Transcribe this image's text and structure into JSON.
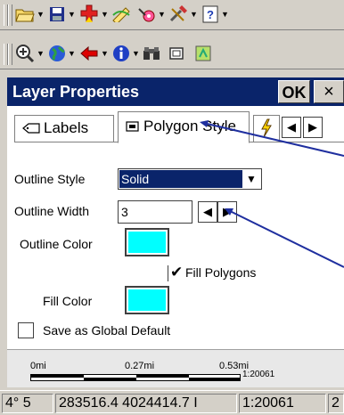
{
  "toolbar1": {
    "icons": [
      "open-folder-icon",
      "save-icon",
      "add-layer-icon",
      "draw-tool-icon",
      "waypoint-icon",
      "tools-icon",
      "help-icon"
    ]
  },
  "toolbar2": {
    "icons": [
      "zoom-in-icon",
      "globe-icon",
      "back-arrow-icon",
      "info-icon",
      "binoculars-icon",
      "window-icon",
      "layer-icon"
    ]
  },
  "dialog": {
    "title": "Layer Properties",
    "ok_label": "OK",
    "close_label": "×",
    "tabs": [
      {
        "label": "Labels",
        "icon": "labels-icon"
      },
      {
        "label": "Polygon Style",
        "icon": "polygon-style-icon"
      }
    ],
    "fields": {
      "outline_style_label": "Outline Style",
      "outline_style_value": "Solid",
      "outline_width_label": "Outline Width",
      "outline_width_value": "3",
      "outline_color_label": "Outline Color",
      "fill_polygons_label": "Fill Polygons",
      "fill_polygons_checked": true,
      "fill_color_label": "Fill Color",
      "save_default_label": "Save as Global Default",
      "save_default_checked": false,
      "outline_color": "#00ffff",
      "fill_color": "#00ffff"
    }
  },
  "scalebar": {
    "ticks": [
      "0mi",
      "0.27mi",
      "0.53mi"
    ],
    "scale": "1:20061"
  },
  "statusbar": {
    "lon": "4° 5",
    "coords": "283516.4 4024414.7 I",
    "scale": "1:20061",
    "extra": "2"
  },
  "colors": {
    "titlebar": "#0a246a",
    "selection": "#0a246a",
    "swatch": "#00ffff",
    "annotation_arrow": "#1f2f9f"
  }
}
